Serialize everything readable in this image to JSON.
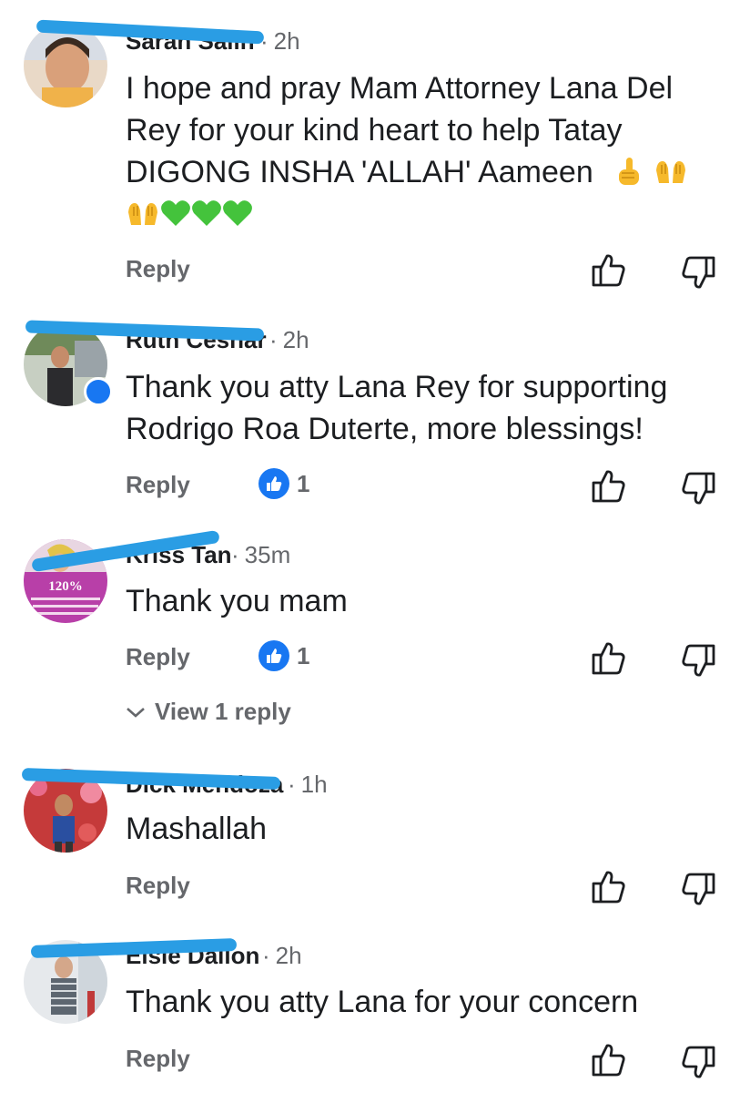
{
  "comments": [
    {
      "author": "Sarah Salih",
      "time": "2h",
      "text_lines": [
        "I hope and pray Mam Attorney Lana Del",
        "Rey  for your kind heart to help Tatay",
        "DIGONG INSHA 'ALLAH' Aameen"
      ],
      "reply_label": "Reply",
      "reaction_count": null
    },
    {
      "author": "Ruth Cesnar",
      "time": "2h",
      "text_lines": [
        "Thank you atty Lana Rey for supporting",
        "Rodrigo Roa Duterte, more blessings!"
      ],
      "reply_label": "Reply",
      "reaction_count": "1"
    },
    {
      "author": "Kriss Tan",
      "time": "35m",
      "text_lines": [
        "Thank you mam"
      ],
      "reply_label": "Reply",
      "reaction_count": "1",
      "view_replies": "View 1 reply",
      "avatar_text": "120%"
    },
    {
      "author": "Dick Mendoza",
      "time": "1h",
      "text_lines": [
        "Mashallah"
      ],
      "reply_label": "Reply",
      "reaction_count": null
    },
    {
      "author": "Elsie Dallon",
      "time": "2h",
      "text_lines": [
        "Thank you atty Lana for your concern"
      ],
      "reply_label": "Reply",
      "reaction_count": null
    }
  ],
  "separator": "·",
  "colors": {
    "redaction": "#2a9de4",
    "like_badge": "#1877f2",
    "secondary_text": "#65676b",
    "heart": "#44c33c"
  },
  "icons": [
    "thumb-up-icon",
    "thumb-down-icon",
    "like-badge-icon",
    "chevron-down-icon",
    "green-heart-emoji",
    "raising-hands-emoji",
    "pointing-up-emoji"
  ]
}
